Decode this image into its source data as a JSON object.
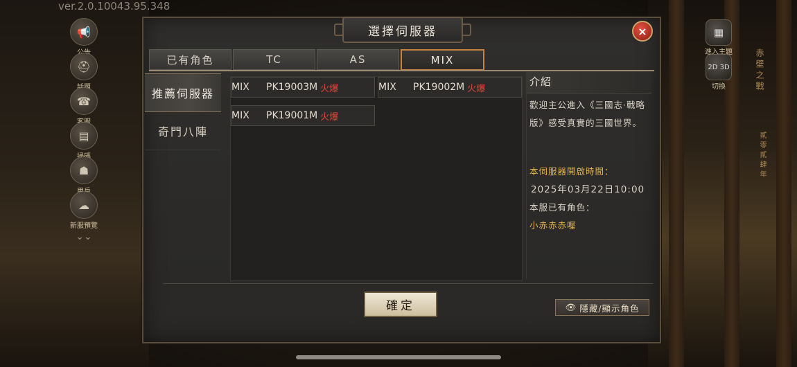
{
  "version": "ver.2.0.10043.95.348",
  "left_sidebar": [
    {
      "label": "公告",
      "icon": "horn-icon"
    },
    {
      "label": "話題",
      "icon": "helmet-icon"
    },
    {
      "label": "客服",
      "icon": "headset-icon"
    },
    {
      "label": "掃碼",
      "icon": "scan-icon"
    },
    {
      "label": "用戶",
      "icon": "user-icon"
    },
    {
      "label": "新服預覽",
      "icon": "preview-icon"
    }
  ],
  "right_buttons": [
    {
      "label": "進入主題",
      "icon": "grid-icon"
    },
    {
      "label": "切換",
      "icon": "2d-3d-icon",
      "glyph": "2D 3D"
    }
  ],
  "right_side_text": [
    "赤",
    "壁",
    "之",
    "戰"
  ],
  "right_side_text2": "貳零貳肆年",
  "dialog": {
    "title": "選擇伺服器",
    "close_icon": "×",
    "tabs": [
      "已有角色",
      "TC",
      "AS",
      "MIX"
    ],
    "active_tab": "MIX",
    "categories": [
      "推薦伺服器",
      "奇門八陣"
    ],
    "active_category": "推薦伺服器",
    "servers": [
      {
        "type": "MIX",
        "name": "PK19003M",
        "tag": "火爆"
      },
      {
        "type": "MIX",
        "name": "PK19002M",
        "tag": "火爆"
      },
      {
        "type": "MIX",
        "name": "PK19001M",
        "tag": "火爆"
      }
    ],
    "intro": {
      "heading": "介紹",
      "text": "歡迎主公進入《三國志·戰略版》感受真實的三國世界。",
      "open_time_label": "本伺服器開啟時間：",
      "open_time": "2025年03月22日10:00",
      "roles_label": "本服已有角色：",
      "role_name": "小赤赤赤喔"
    },
    "confirm_label": "確定",
    "toggle_label": "隱藏/顯示角色"
  },
  "colors": {
    "hot_tag": "#e0463a",
    "gold": "#e2b14a",
    "active_tab_border": "#c8843d"
  }
}
